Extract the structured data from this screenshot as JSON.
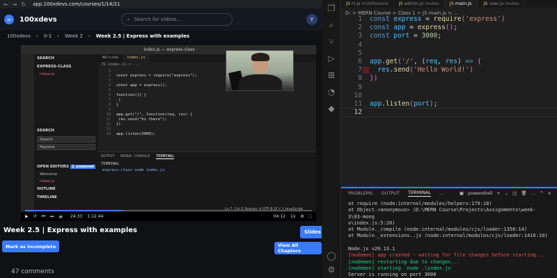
{
  "browser": {
    "url": "app.100xdevs.com/courses/1/14/21",
    "logo_mark": "∞",
    "logo": "100xdevs",
    "search_placeholder": "Search for videos...",
    "avatar": "Y",
    "breadcrumbs": [
      "100xdevs",
      "0-1",
      "Week 2",
      "Week 2.5 | Express with examples"
    ],
    "lesson_title": "Week 2.5 | Express with examples",
    "slides": "Slides",
    "mark_incomplete": "Mark as Incomplete",
    "view_chapters": "View All Chapters",
    "comments": "47 comments"
  },
  "video": {
    "window_title": "index.js — express-class",
    "side_search": "SEARCH",
    "explorer": "EXPRESS-CLASS",
    "file": "index.js",
    "search_section": "SEARCH",
    "search_ph": "Search",
    "replace_ph": "Replace",
    "open_editors": "OPEN EDITORS",
    "unsaved": "1 unsaved",
    "welcome": "Welcome",
    "outline": "OUTLINE",
    "timeline": "TIMELINE",
    "tabs": [
      "Welcome",
      "index.js"
    ],
    "crumb": "JS index.js > ...",
    "code": [
      {
        "n": "1",
        "t": ""
      },
      {
        "n": "2",
        "t": "const express = require(\"express\");"
      },
      {
        "n": "3",
        "t": ""
      },
      {
        "n": "4",
        "t": "const app = express();"
      },
      {
        "n": "5",
        "t": ""
      },
      {
        "n": "6",
        "t": "function(){ }"
      },
      {
        "n": "7",
        "t": "  |"
      },
      {
        "n": "8",
        "t": "}"
      },
      {
        "n": "9",
        "t": ""
      },
      {
        "n": "10",
        "t": "app.get(\"/\", function(req, res) {"
      },
      {
        "n": "11",
        "t": "  res.send(\"hi there\");"
      },
      {
        "n": "12",
        "t": "})"
      },
      {
        "n": "13",
        "t": ""
      },
      {
        "n": "14",
        "t": "app.listen(3000);"
      }
    ],
    "panel_tabs": [
      "OUTPUT",
      "DEBUG CONSOLE",
      "TERMINAL"
    ],
    "terminal_label": "TERMINAL",
    "terminal_line": "express-class node index.js",
    "status": "Ln 7, Col 5   Spaces: 4   UTF-8   LF   { } JavaScript",
    "time_current": "24:33",
    "time_total": "1:12:44",
    "time_right": "04:12",
    "speed": "1x",
    "progress": 0.34
  },
  "vscode": {
    "tabs": [
      {
        "label": "rt.js",
        "sub": "middleware",
        "active": false
      },
      {
        "label": "admin.js",
        "sub": "routes",
        "active": false
      },
      {
        "label": "main.js",
        "sub": "",
        "active": true
      },
      {
        "label": "user.js",
        "sub": "routes",
        "active": false
      }
    ],
    "breadcrumb": "D: > MERN Course > Class 1 > JS main.js > ...",
    "panel_tabs": [
      "PROBLEMS",
      "OUTPUT",
      "TERMINAL"
    ],
    "shell": "powershell",
    "terminal": [
      {
        "text": "    at require (node:internal/modules/helpers:179:18)",
        "cls": ""
      },
      {
        "text": "    at Object.<anonymous> (D:\\MERN Course\\Projects\\Assignments\\week-3\\03-mong",
        "cls": ""
      },
      {
        "text": "o\\index.js:5:20)",
        "cls": ""
      },
      {
        "text": "    at Module._compile (node:internal/modules/cjs/loader:1358:14)",
        "cls": ""
      },
      {
        "text": "    at Module._extensions..js (node:internal/modules/cjs/loader:1416:10)",
        "cls": ""
      },
      {
        "text": "",
        "cls": ""
      },
      {
        "text": "Node.js v20.13.1",
        "cls": ""
      },
      {
        "text": "[nodemon] app crashed - waiting for file changes before starting...",
        "cls": "t-red"
      },
      {
        "text": "[nodemon] restarting due to changes...",
        "cls": "t-green"
      },
      {
        "text": "[nodemon] starting `node .\\index.js`",
        "cls": "t-green"
      },
      {
        "text": "Server is running on port 3000",
        "cls": ""
      },
      {
        "text": "[",
        "cls": ""
      }
    ]
  }
}
